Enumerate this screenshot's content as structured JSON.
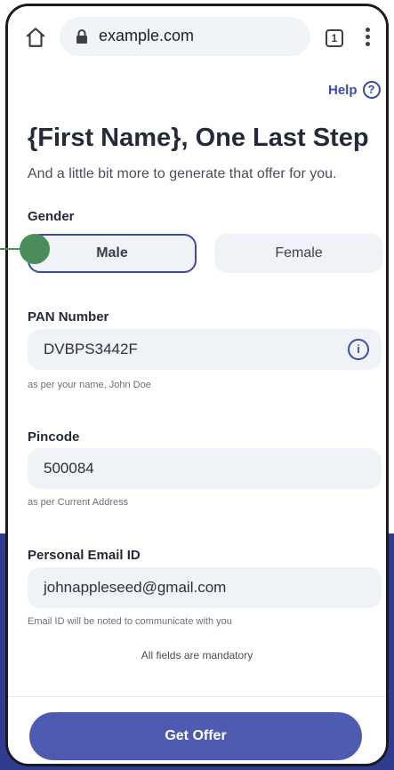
{
  "browser": {
    "url": "example.com",
    "tab_count": "1"
  },
  "header": {
    "help_label": "Help",
    "help_icon": "?"
  },
  "form": {
    "title": "{First Name}, One Last Step",
    "subtitle": "And a little bit more to generate that offer for you.",
    "gender": {
      "label": "Gender",
      "options": [
        "Male",
        "Female"
      ],
      "selected": "Male"
    },
    "pan": {
      "label": "PAN Number",
      "value": "DVBPS3442F",
      "hint": "as per your name, John Doe",
      "info_icon": "i"
    },
    "pincode": {
      "label": "Pincode",
      "value": "500084",
      "hint": "as per Current Address"
    },
    "email": {
      "label": "Personal Email ID",
      "value": "johnappleseed@gmail.com",
      "hint": "Email ID will be noted to communicate with you"
    },
    "mandatory_note": "All fields are mandatory",
    "submit_label": "Get Offer"
  },
  "colors": {
    "accent": "#3d4aa8",
    "button": "#4d5bb0",
    "field_bg": "#eff3f8",
    "tap_indicator": "#4a8c5a"
  }
}
